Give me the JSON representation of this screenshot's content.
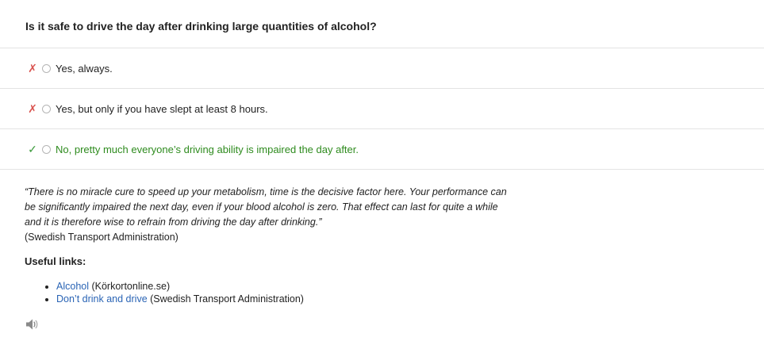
{
  "question": "Is it safe to drive the day after drinking large quantities of alcohol?",
  "answers": [
    {
      "mark": "✗",
      "text": "Yes, always."
    },
    {
      "mark": "✗",
      "text": "Yes, but only if you have slept at least 8 hours."
    },
    {
      "mark": "✓",
      "text": "No, pretty much everyone’s driving ability is impaired the day after."
    }
  ],
  "quote": {
    "text": "“There is no miracle cure to speed up your metabolism, time is the decisive factor here. Your performance can be significantly impaired the next day, even if your blood alcohol is zero. That effect can last for quite a while and it is therefore wise to refrain from driving the day after drinking.”",
    "source": "(Swedish Transport Administration)"
  },
  "useful_links": {
    "title": "Useful links:",
    "items": [
      {
        "link_text": "Alcohol",
        "source": " (Körkortonline.se)"
      },
      {
        "link_text": "Don’t drink and drive",
        "source": " (Swedish Transport Administration)"
      }
    ]
  },
  "audio_icon": "speaker-icon",
  "colors": {
    "wrong_mark": "#d9534f",
    "correct_mark": "#3a9a3a",
    "correct_text": "#2e8b1e",
    "link": "#2a64b5"
  }
}
